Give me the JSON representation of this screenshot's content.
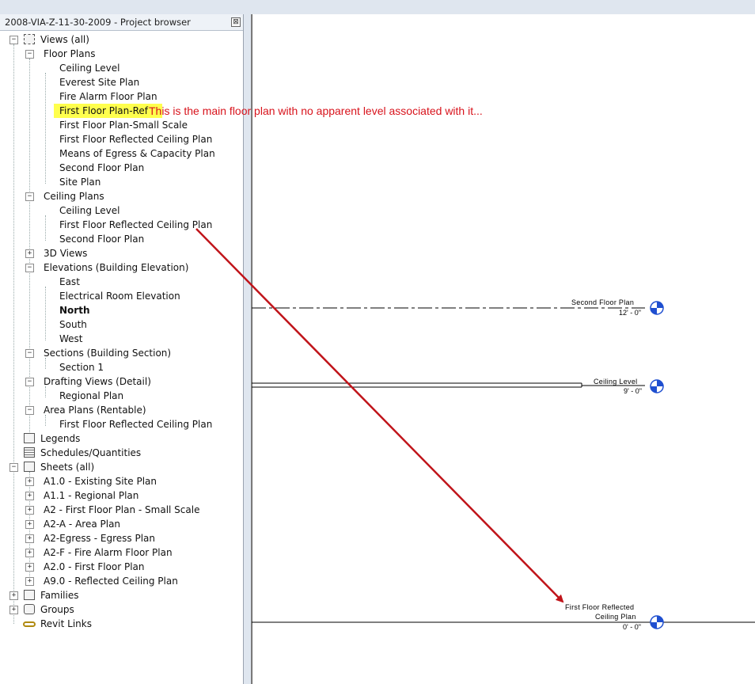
{
  "browser": {
    "title": "2008-VIA-Z-11-30-2009 - Project browser",
    "close_glyph": "⊠"
  },
  "tree": {
    "views_all": "Views (all)",
    "floor_plans": {
      "label": "Floor Plans",
      "items": [
        "Ceiling Level",
        "Everest Site Plan",
        "Fire Alarm Floor Plan",
        "First Floor Plan-Ref",
        "First Floor Plan-Small Scale",
        "First Floor Reflected Ceiling Plan",
        "Means of Egress & Capacity Plan",
        "Second Floor Plan",
        "Site Plan"
      ]
    },
    "ceiling_plans": {
      "label": "Ceiling Plans",
      "items": [
        "Ceiling Level",
        "First Floor Reflected Ceiling Plan",
        "Second Floor Plan"
      ]
    },
    "views_3d": "3D Views",
    "elevations": {
      "label": "Elevations (Building Elevation)",
      "items": [
        "East",
        "Electrical Room Elevation",
        "North",
        "South",
        "West"
      ]
    },
    "sections": {
      "label": "Sections (Building Section)",
      "items": [
        "Section 1"
      ]
    },
    "drafting": {
      "label": "Drafting Views (Detail)",
      "items": [
        "Regional Plan"
      ]
    },
    "area_plans": {
      "label": "Area Plans (Rentable)",
      "items": [
        "First Floor Reflected Ceiling Plan"
      ]
    },
    "legends": "Legends",
    "schedules": "Schedules/Quantities",
    "sheets": {
      "label": "Sheets (all)",
      "items": [
        "A1.0 - Existing Site Plan",
        "A1.1 - Regional Plan",
        "A2 - First Floor Plan - Small Scale",
        "A2-A - Area Plan",
        "A2-Egress - Egress Plan",
        "A2-F - Fire Alarm Floor Plan",
        "A2.0 - First Floor Plan",
        "A9.0 - Reflected Ceiling Plan"
      ]
    },
    "families": "Families",
    "groups": "Groups",
    "revit_links": "Revit Links"
  },
  "annotation": "This is the main floor plan with no apparent level associated with it...",
  "levels": [
    {
      "name": "Second Floor Plan",
      "elevation": "12' - 0\""
    },
    {
      "name": "Ceiling Level",
      "elevation": "9' - 0\""
    },
    {
      "name_line1": "First Floor Reflected",
      "name_line2": "Ceiling Plan",
      "elevation": "0' - 0\""
    }
  ],
  "colors": {
    "annotation": "#d8131c",
    "highlight": "#ffff4d",
    "level_marker": "#1f4fd0",
    "arrow": "#c0141a"
  }
}
